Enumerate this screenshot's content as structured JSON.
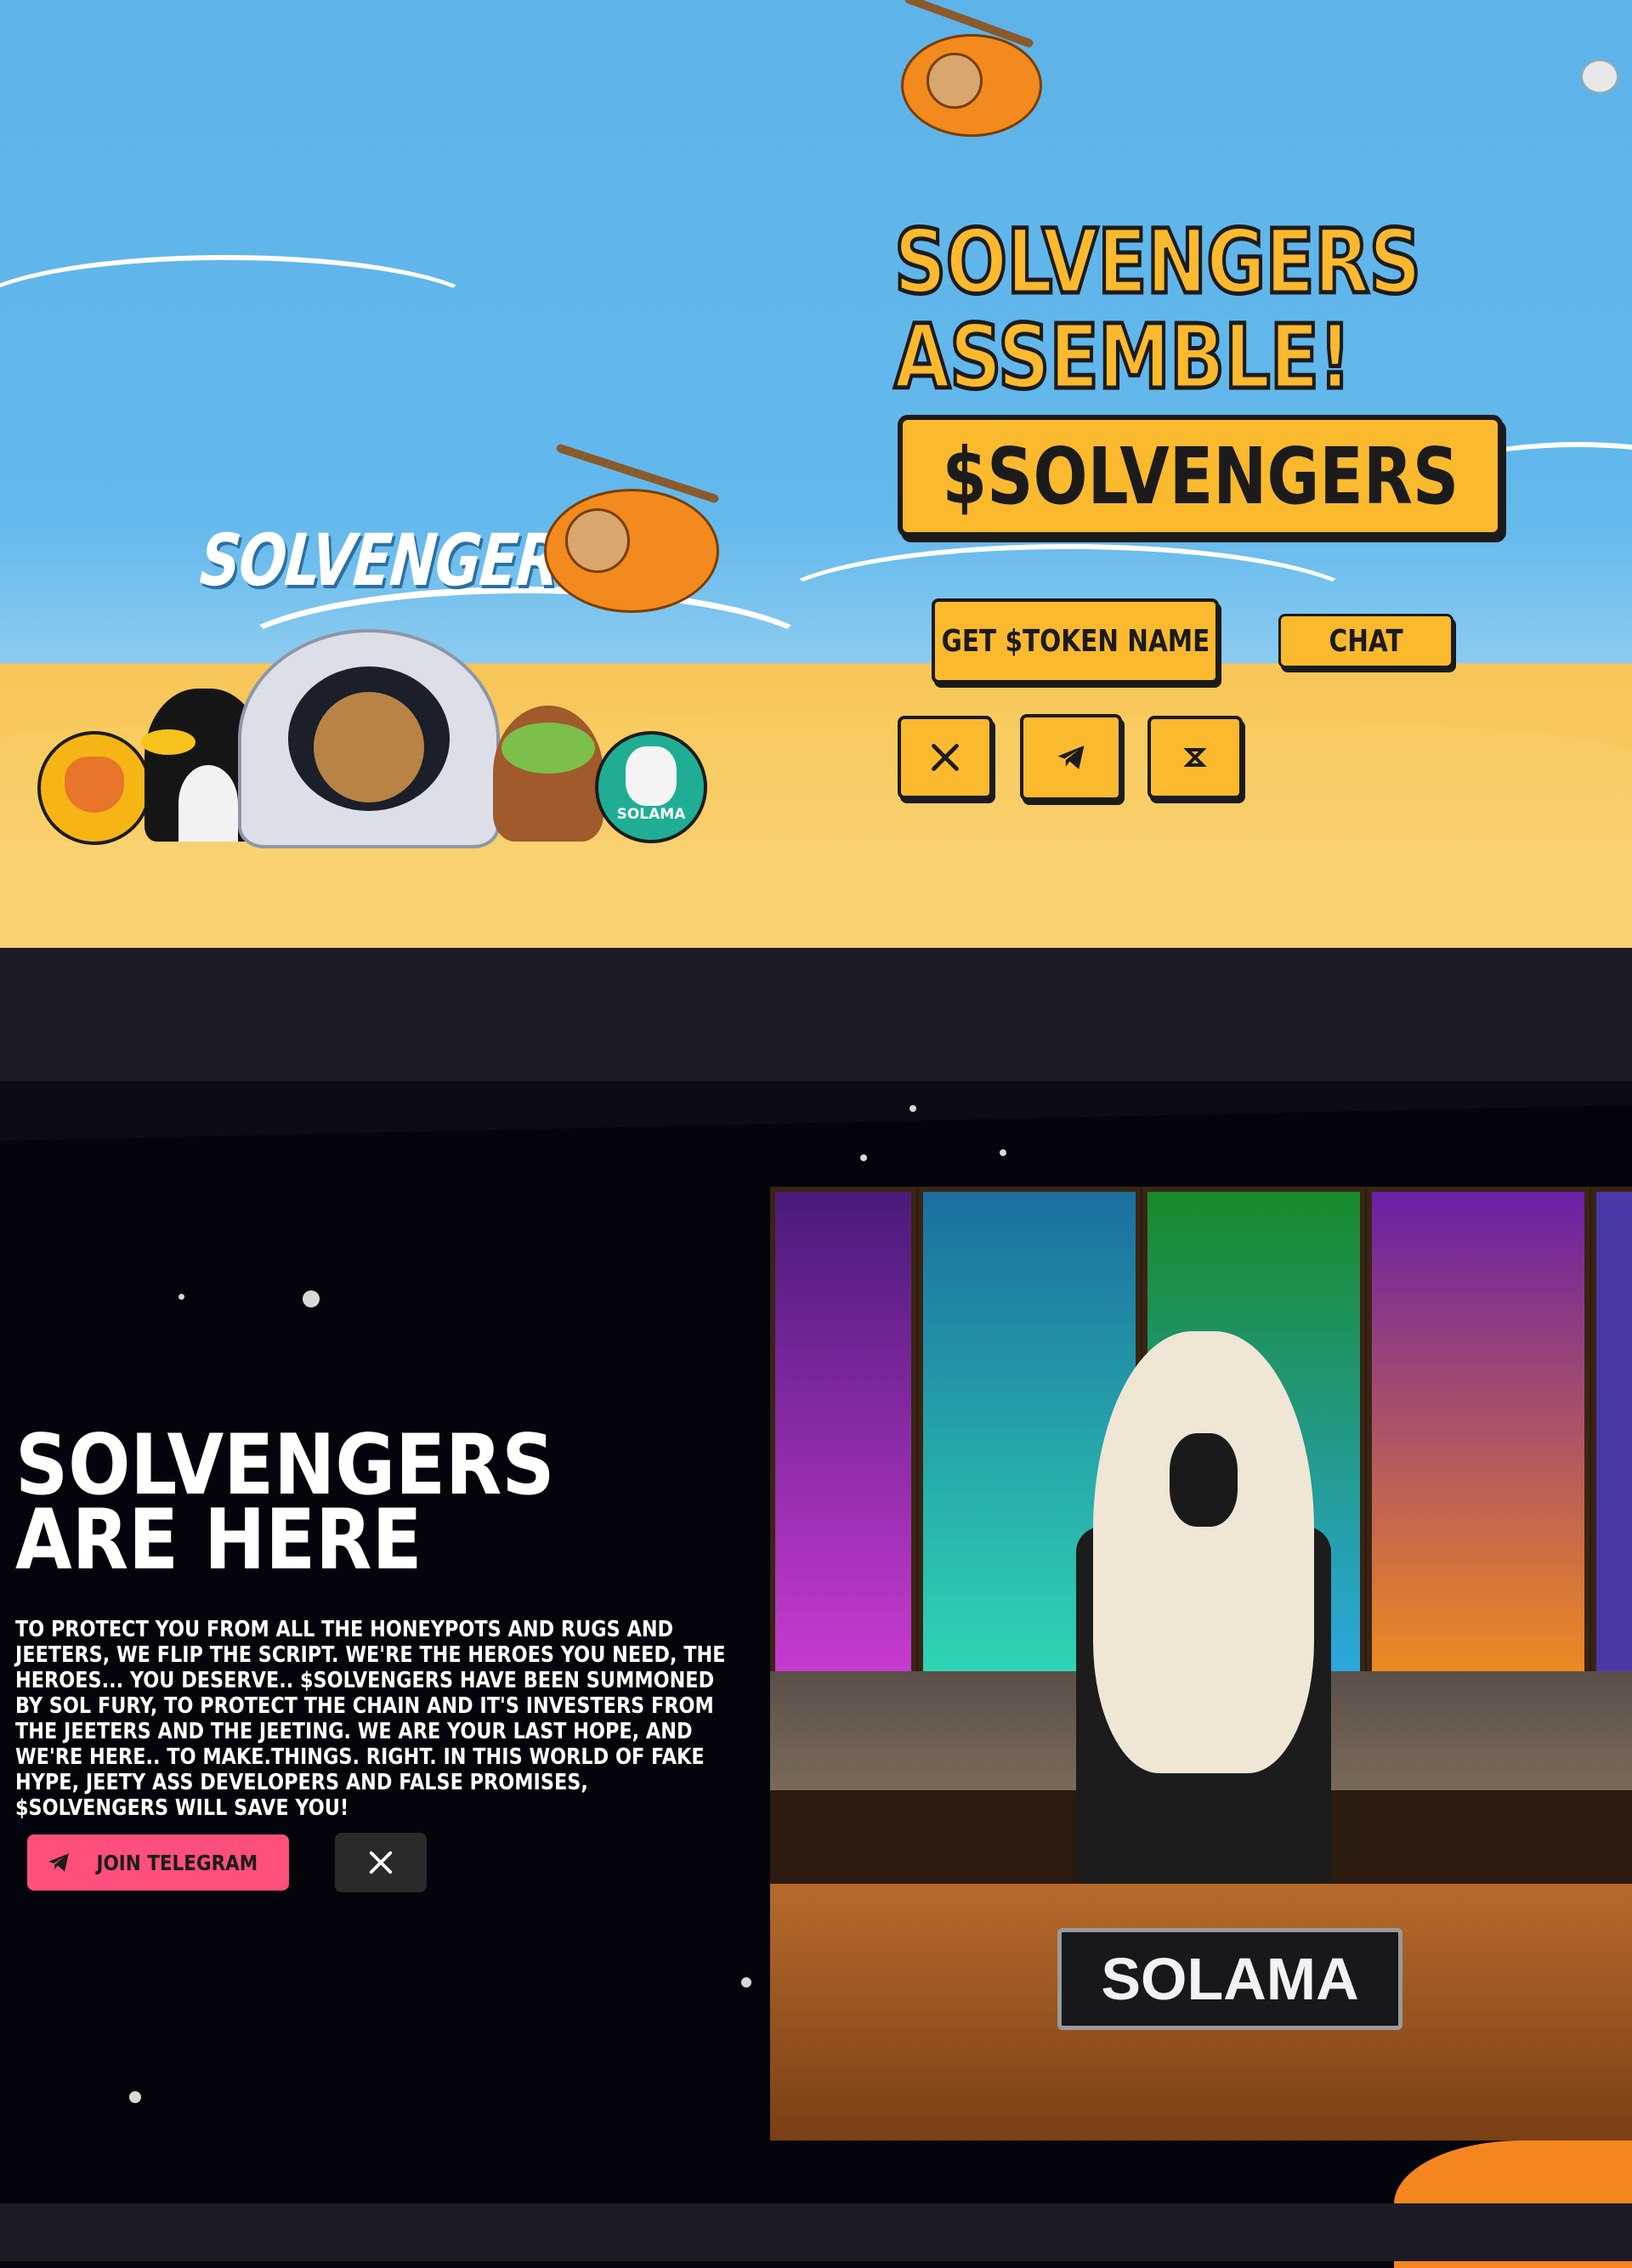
{
  "hero": {
    "title_line1": "SOLVENGERS",
    "title_line2": "ASSEMBLE!",
    "ticker": "$SOLVENGERS",
    "logo_word": "SOLVENGERS",
    "buy_button": "GET $TOKEN NAME",
    "chat_button": "CHAT",
    "coin_label": "SOLAMA",
    "socials": [
      "x-icon",
      "telegram-icon",
      "dexscreener-icon"
    ]
  },
  "about": {
    "title": "SOLVENGERS ARE HERE",
    "body": "To protect you from all the honeypots and rugs and jeeters, we flip the script. We're the heroes you need, the heroes... you deserve.. $Solvengers have been summoned by Sol Fury, to protect the chain and it's investers from the jeeters and the jeeting. We are your last hope, and we're here.. to make.things. right. In this world of fake hype, jeety ass developers and false promises, $Solvengers will save you!",
    "telegram_button": "JOIN TELEGRAM"
  },
  "artwork": {
    "nameplate": "SOLAMA"
  },
  "colors": {
    "sky": "#5db3e8",
    "accent_yellow": "#fbb92e",
    "telegram_pink": "#ff4f7b",
    "dark_band": "#1b1b26",
    "space": "#04040c"
  }
}
